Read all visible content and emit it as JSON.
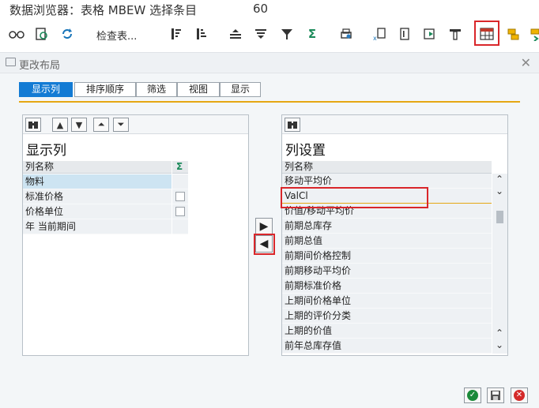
{
  "window": {
    "title": "数据浏览器：表格 MBEW 选择条目",
    "count": "60"
  },
  "toolbar": {
    "check_table_label": "检查表...",
    "icons": [
      "glasses-icon",
      "refresh-doc-icon",
      "recycle-icon",
      "sort-asc-icon",
      "sort-desc-icon",
      "align-center-icon",
      "align-bottom-icon",
      "filter-icon",
      "sum-icon",
      "print-icon",
      "export-icon",
      "doc-edit-icon",
      "doc-export-icon",
      "upload-icon",
      "layout-grid-icon",
      "add-layout-icon",
      "more-icon"
    ],
    "sum_symbol": "Σ"
  },
  "dialog": {
    "title": "更改布局",
    "tabs": [
      {
        "label": "显示列",
        "active": true
      },
      {
        "label": "排序顺序",
        "active": false
      },
      {
        "label": "筛选",
        "active": false
      },
      {
        "label": "视图",
        "active": false
      },
      {
        "label": "显示",
        "active": false
      }
    ]
  },
  "left_panel": {
    "title": "显示列",
    "column_header": "列名称",
    "sum_header": "Σ",
    "rows": [
      {
        "label": "物料",
        "selected": true,
        "checkbox": false
      },
      {
        "label": "标准价格",
        "selected": false,
        "checkbox": true
      },
      {
        "label": "价格单位",
        "selected": false,
        "checkbox": true
      },
      {
        "label": "年 当前期间",
        "selected": false,
        "checkbox": false
      }
    ]
  },
  "right_panel": {
    "title": "列设置",
    "column_header": "列名称",
    "rows": [
      "移动平均价",
      "ValCl",
      "价值/移动平均价",
      "前期总库存",
      "前期总值",
      "前期间价格控制",
      "前期移动平均价",
      "前期标准价格",
      "上期间价格单位",
      "上期的评价分类",
      "上期的价值",
      "前年总库存值"
    ]
  },
  "colors": {
    "accent": "#137bd4",
    "highlight": "#d9262a",
    "tab_line": "#e5a713"
  }
}
